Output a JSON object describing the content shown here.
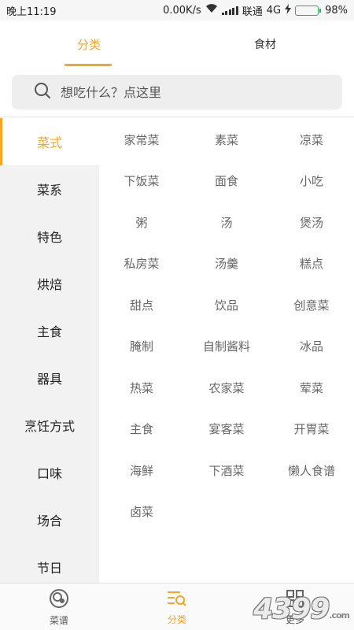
{
  "status_bar": {
    "time": "晚上11:19",
    "network_speed": "0.00K/s",
    "carrier": "联通",
    "network_type": "4G",
    "battery": "98%",
    "battery_level": 0.98,
    "accent_color": "#2ab24a"
  },
  "top_tabs": {
    "category_label": "分类",
    "ingredients_label": "食材"
  },
  "search": {
    "placeholder": "想吃什么？点这里"
  },
  "sidebar": {
    "items": [
      {
        "label": "菜式",
        "active": true
      },
      {
        "label": "菜系"
      },
      {
        "label": "特色"
      },
      {
        "label": "烘焙"
      },
      {
        "label": "主食"
      },
      {
        "label": "器具"
      },
      {
        "label": "烹饪方式"
      },
      {
        "label": "口味"
      },
      {
        "label": "场合"
      },
      {
        "label": "节日"
      }
    ]
  },
  "categories": [
    "家常菜",
    "素菜",
    "凉菜",
    "下饭菜",
    "面食",
    "小吃",
    "粥",
    "汤",
    "煲汤",
    "私房菜",
    "汤羹",
    "糕点",
    "甜点",
    "饮品",
    "创意菜",
    "腌制",
    "自制酱料",
    "冰品",
    "热菜",
    "农家菜",
    "荤菜",
    "主食",
    "宴客菜",
    "开胃菜",
    "海鲜",
    "下酒菜",
    "懒人食谱",
    "卤菜"
  ],
  "bottom_nav": {
    "recipes_label": "菜谱",
    "category_label": "分类",
    "more_label": "更多"
  },
  "watermark": {
    "text": "4399",
    "suffix": ".com"
  },
  "colors": {
    "accent": "#f5a623",
    "sidebar_bg": "#f2f2f2",
    "search_bg": "#eeeeee"
  },
  "icons": {
    "search": "search-icon",
    "recipes": "recipe-bowl-icon",
    "category": "list-search-icon",
    "more": "grid-icon",
    "wifi": "wifi-icon",
    "signal": "signal-icon",
    "charging": "charging-icon",
    "battery": "battery-icon"
  }
}
